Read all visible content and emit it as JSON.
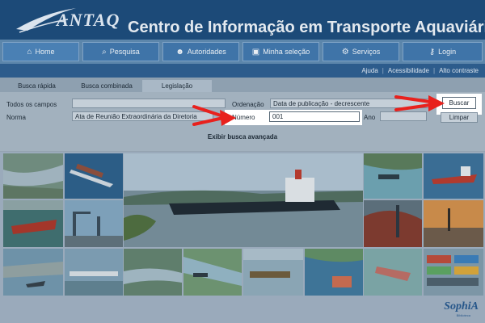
{
  "header": {
    "logo_text": "ANTAQ",
    "title": "Centro de Informação em Transporte Aquaviário"
  },
  "nav": {
    "items": [
      {
        "label": "Home",
        "icon": "home-icon"
      },
      {
        "label": "Pesquisa",
        "icon": "search-icon"
      },
      {
        "label": "Autoridades",
        "icon": "user-icon"
      },
      {
        "label": "Minha seleção",
        "icon": "basket-icon"
      },
      {
        "label": "Serviços",
        "icon": "gears-icon"
      },
      {
        "label": "Login",
        "icon": "key-icon"
      }
    ]
  },
  "util_links": {
    "ajuda": "Ajuda",
    "acessibilidade": "Acessibilidade",
    "alto_contraste": "Alto contraste"
  },
  "tabs": [
    {
      "label": "Busca rápida"
    },
    {
      "label": "Busca combinada"
    },
    {
      "label": "Legislação"
    }
  ],
  "form": {
    "todos_label": "Todos os campos",
    "todos_value": "",
    "norma_label": "Norma",
    "norma_value": "Ata de Reunião Extraordinária da Diretoria",
    "ordenacao_label": "Ordenação",
    "ordenacao_value": "Data de publicação - decrescente",
    "numero_label": "Número",
    "numero_value": "001",
    "ano_label": "Ano",
    "ano_value": "",
    "buscar_label": "Buscar",
    "limpar_label": "Limpar",
    "advanced_label": "Exibir busca avançada"
  },
  "footer": {
    "brand": "SophiA",
    "brand_sub": "Biblioteca"
  },
  "colors": {
    "header": "#1c4a78",
    "nav": "#5c86ab",
    "annotation_arrow": "#e8211d"
  }
}
